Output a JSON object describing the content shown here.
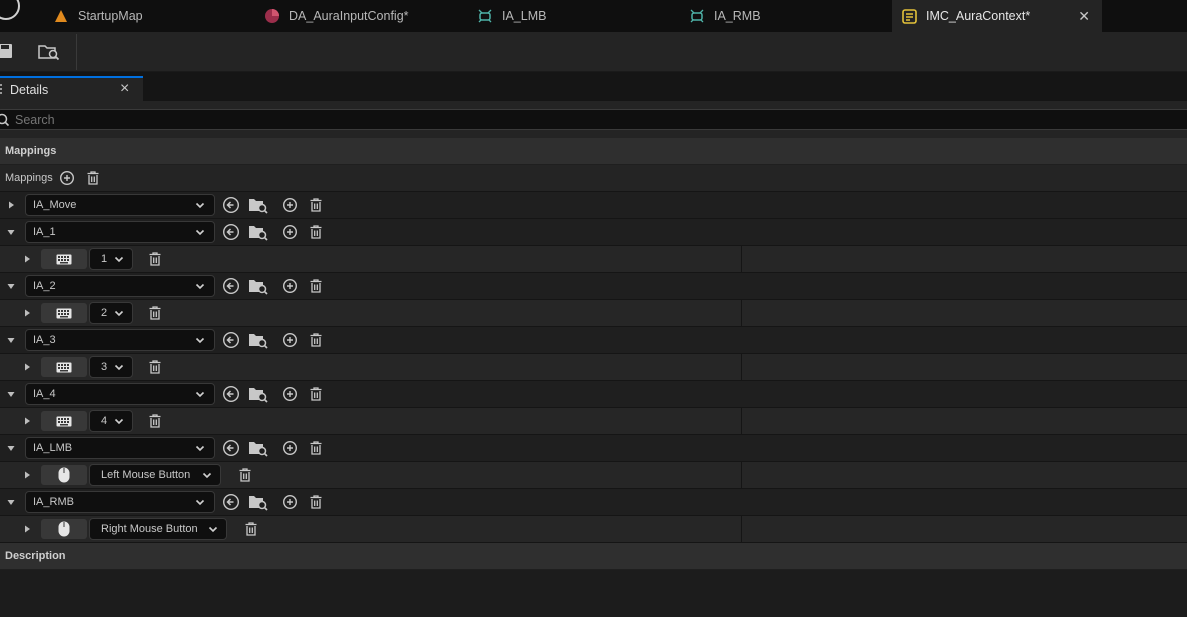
{
  "tabs": [
    {
      "label": "StartupMap",
      "icon": "level-icon"
    },
    {
      "label": "DA_AuraInputConfig*",
      "icon": "data-asset-icon"
    },
    {
      "label": "IA_LMB",
      "icon": "input-action-icon"
    },
    {
      "label": "IA_RMB",
      "icon": "input-action-icon"
    },
    {
      "label": "IMC_AuraContext*",
      "icon": "input-mapping-context-icon",
      "active": true
    }
  ],
  "details": {
    "tab_label": "Details",
    "close_glyph": "×",
    "search_placeholder": "Search"
  },
  "categories": {
    "mappings": "Mappings",
    "description": "Description"
  },
  "mappings_label": "Mappings",
  "mappings": [
    {
      "action": "IA_Move",
      "expanded": false
    },
    {
      "action": "IA_1",
      "expanded": true,
      "key_type": "keyboard",
      "key": "1"
    },
    {
      "action": "IA_2",
      "expanded": true,
      "key_type": "keyboard",
      "key": "2"
    },
    {
      "action": "IA_3",
      "expanded": true,
      "key_type": "keyboard",
      "key": "3"
    },
    {
      "action": "IA_4",
      "expanded": true,
      "key_type": "keyboard",
      "key": "4"
    },
    {
      "action": "IA_LMB",
      "expanded": true,
      "key_type": "mouse",
      "key": "Left Mouse Button"
    },
    {
      "action": "IA_RMB",
      "expanded": true,
      "key_type": "mouse",
      "key": "Right Mouse Button"
    }
  ],
  "colors": {
    "accent": "#0070e0",
    "panel": "#242424",
    "field": "#0f0f0f"
  }
}
